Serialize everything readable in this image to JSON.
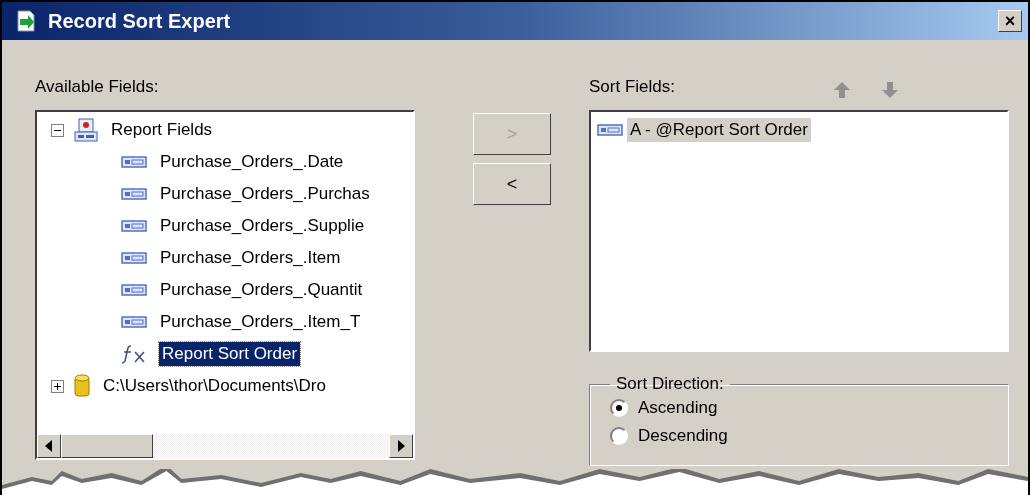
{
  "window": {
    "title": "Record Sort Expert",
    "close_label": "×"
  },
  "available": {
    "label": "Available Fields:",
    "tree": [
      {
        "kind": "table",
        "label": "Report Fields",
        "expanded": true,
        "selected": false,
        "children": [
          {
            "kind": "field",
            "label": "Purchase_Orders_.Date",
            "selected": false
          },
          {
            "kind": "field",
            "label": "Purchase_Orders_.Purchas",
            "selected": false
          },
          {
            "kind": "field",
            "label": "Purchase_Orders_.Supplie",
            "selected": false
          },
          {
            "kind": "field",
            "label": "Purchase_Orders_.Item",
            "selected": false
          },
          {
            "kind": "field",
            "label": "Purchase_Orders_.Quantit",
            "selected": false
          },
          {
            "kind": "field",
            "label": "Purchase_Orders_.Item_T",
            "selected": false
          },
          {
            "kind": "formula",
            "label": "Report Sort Order",
            "selected": true
          }
        ]
      },
      {
        "kind": "database",
        "label": "C:\\Users\\thor\\Documents\\Dro",
        "expanded": false,
        "selected": false
      }
    ]
  },
  "transfer_buttons": [
    {
      "label": ">",
      "disabled": true
    },
    {
      "label": "<",
      "disabled": false
    }
  ],
  "sort_fields": {
    "label": "Sort Fields:",
    "items": [
      {
        "label": "A - @Report Sort Order",
        "selected": true
      }
    ]
  },
  "sort_direction": {
    "label": "Sort Direction:",
    "options": [
      {
        "label": "Ascending",
        "selected": true
      },
      {
        "label": "Descending",
        "selected": false
      }
    ]
  }
}
